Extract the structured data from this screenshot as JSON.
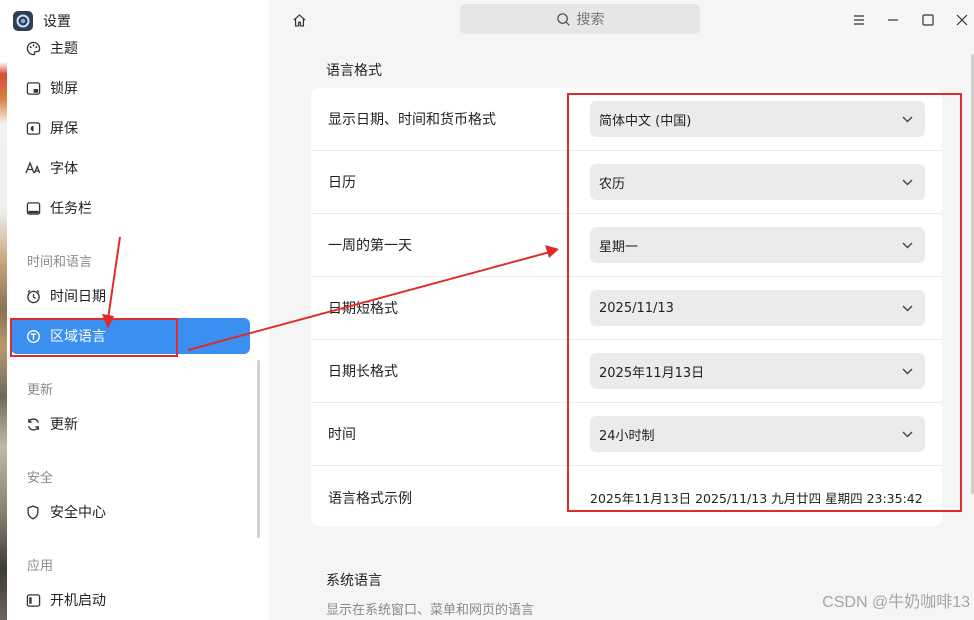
{
  "app": {
    "title": "设置"
  },
  "sidebar": {
    "items": [
      {
        "label": "主题",
        "icon": "palette-icon"
      },
      {
        "label": "锁屏",
        "icon": "lock-screen-icon"
      },
      {
        "label": "屏保",
        "icon": "screensaver-icon"
      },
      {
        "label": "字体",
        "icon": "font-icon"
      },
      {
        "label": "任务栏",
        "icon": "taskbar-icon"
      }
    ],
    "groups": [
      {
        "title": "时间和语言",
        "items": [
          {
            "label": "时间日期",
            "icon": "clock-icon"
          },
          {
            "label": "区域语言",
            "icon": "region-language-icon",
            "active": true
          }
        ]
      },
      {
        "title": "更新",
        "items": [
          {
            "label": "更新",
            "icon": "refresh-icon"
          }
        ]
      },
      {
        "title": "安全",
        "items": [
          {
            "label": "安全中心",
            "icon": "shield-icon"
          }
        ]
      },
      {
        "title": "应用",
        "items": [
          {
            "label": "开机启动",
            "icon": "startup-icon"
          }
        ]
      }
    ]
  },
  "header": {
    "search_placeholder": "搜索"
  },
  "main": {
    "format_section": {
      "title": "语言格式",
      "rows": [
        {
          "label": "显示日期、时间和货币格式",
          "value": "简体中文 (中国)"
        },
        {
          "label": "日历",
          "value": "农历"
        },
        {
          "label": "一周的第一天",
          "value": "星期一"
        },
        {
          "label": "日期短格式",
          "value": "2025/11/13"
        },
        {
          "label": "日期长格式",
          "value": "2025年11月13日"
        },
        {
          "label": "时间",
          "value": "24小时制"
        }
      ],
      "example": {
        "label": "语言格式示例",
        "value": "2025年11月13日  2025/11/13  九月廿四  星期四  23:35:42"
      }
    },
    "system_language": {
      "title": "系统语言",
      "subtitle": "显示在系统窗口、菜单和网页的语言"
    }
  },
  "watermark": "CSDN @牛奶咖啡13",
  "colors": {
    "accent": "#3b8ff0",
    "annotation": "#e02b2b"
  }
}
